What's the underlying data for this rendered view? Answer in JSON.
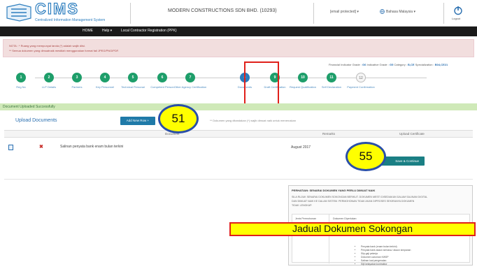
{
  "header": {
    "logo_text": "CIMS",
    "logo_sub": "Centralized Information Management System",
    "company": "MODERN CONSTRUCTIONS SDN BHD. (10293)",
    "email": "[email protected] ▾",
    "language": "Bahasa Malaysia ▾",
    "logout": "Logout"
  },
  "nav": {
    "home": "HOME",
    "help": "Help ▾",
    "registration": "Local Contractor Registration (PPK)"
  },
  "note": {
    "line1": "NOTA : * Ruang yang mempunyai tanda (*) adalah wajib diisi.",
    "line2": "** Semua dokumen yang dimuatnaik mestilah menggunakan format fail JPEG/PNG/PDF."
  },
  "grades": {
    "fin_label": "Financial Indicator Grade :",
    "fin_value": "G6",
    "ind_label": "Indicative Grade :",
    "ind_value": "G5",
    "cat_label": "Category :",
    "cat_value": "B,CE",
    "spec_label": "Specialization :",
    "spec_value": "B04,CE21"
  },
  "steps": [
    {
      "num": "1",
      "label": "Reg No",
      "state": "done"
    },
    {
      "num": "2",
      "label": "LLP Details",
      "state": "done"
    },
    {
      "num": "3",
      "label": "Partners",
      "state": "done"
    },
    {
      "num": "4",
      "label": "Key Personnel",
      "state": "done"
    },
    {
      "num": "5",
      "label": "Technical Personal",
      "state": "done"
    },
    {
      "num": "6",
      "label": "Competent Person",
      "state": "done"
    },
    {
      "num": "7",
      "label": "Other Agency Certification",
      "state": "done"
    },
    {
      "num": "8",
      "label": "Documents",
      "state": "current"
    },
    {
      "num": "9",
      "label": "Draft Certification",
      "state": "done"
    },
    {
      "num": "10",
      "label": "Request Qualification",
      "state": "done"
    },
    {
      "num": "11",
      "label": "Self Declaration",
      "state": "done"
    },
    {
      "num": "12",
      "label": "Payment Confirmation",
      "state": "todo"
    }
  ],
  "success_msg": "Document Uploaded Successfully",
  "upload": {
    "title": "Upload Documents",
    "add_button": "Add New Row +",
    "note": "** Dokumen yang ditandakan (*) wajib dimuat naik untuk meneruskan"
  },
  "table": {
    "headers": {
      "document": "Document",
      "remarks": "Remarks",
      "certificate": "Upload Certificate"
    },
    "rows": [
      {
        "document": "Salinan penyata bank enam bulan terkini",
        "remarks": "August 2017"
      }
    ]
  },
  "save_button": "Save & Continue",
  "panel": {
    "title": "PERHATIAN: SENARAI DOKUMEN YANG PERLU DIMUAT NAIK",
    "text1": "SILA RUJUK SENARAI DOKUMEN SOKONGAN BERIKUT. DOKUMEN MESTI DISEDIAKAN DALAM SALINAN DIGITAL",
    "text2": "DAN DIMUAT NAIK KE DALAM SISTEM. PERMOHONAN TIDAK AKAN DIPROSES SEKIRANYA DOKUMEN",
    "text3": "TIDAK LENGKAP.",
    "col1": "Jenis Permohonan",
    "col2": "Dokumen Diperlukan",
    "items": [
      "Penyata bank (enam bulan terkini)",
      "Penyata bank akaun semasa / akaun simpanan",
      "Slip gaji pekerja",
      "Dokumen caruman KWSP",
      "Salinan kad pengenalan",
      "Sijil kelayakan kontraktor"
    ]
  },
  "annotations": {
    "jadual": "Jadual Dokumen Sokongan",
    "callout1": "51",
    "callout2": "55"
  }
}
